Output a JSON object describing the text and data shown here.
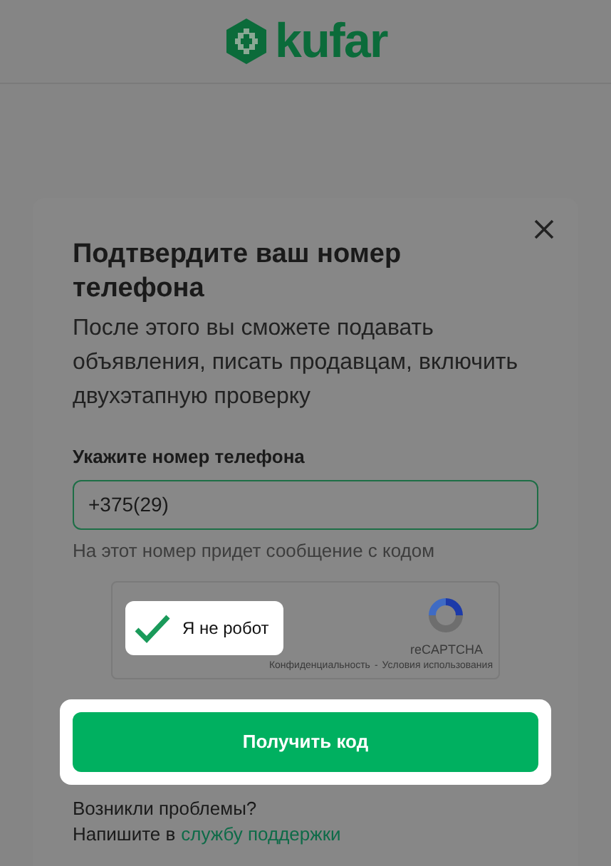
{
  "header": {
    "logo_text": "kufar"
  },
  "dialog": {
    "title": "Подтвердите ваш номер телефона",
    "description": "После этого вы сможете подавать объявления, писать продавцам, включить двухэтапную проверку",
    "phone": {
      "label": "Укажите номер телефона",
      "value": "+375(29)",
      "helper": "На этот номер придет сообщение с кодом"
    },
    "captcha": {
      "label": "Я не робот",
      "checked": true,
      "brand": "reCAPTCHA",
      "privacy_link": "Конфиденциальность",
      "separator": "-",
      "terms_link": "Условия использования"
    },
    "submit": "Получить код",
    "help": {
      "question": "Возникли проблемы?",
      "prefix": "Напишите в",
      "link": "службу поддержки"
    }
  }
}
